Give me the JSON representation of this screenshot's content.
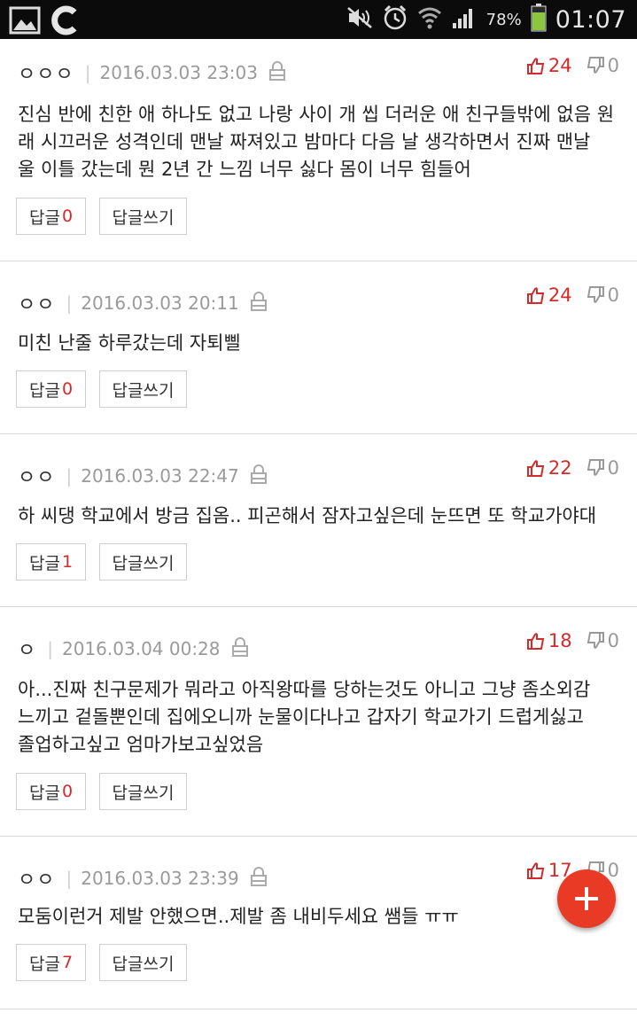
{
  "status_bar": {
    "battery": "78%",
    "time": "01:07",
    "icons": [
      "gallery-icon",
      "app-c-icon",
      "mute-icon",
      "alarm-icon",
      "wifi-icon",
      "signal-icon",
      "battery-icon"
    ]
  },
  "labels": {
    "reply": "답글",
    "write_reply": "답글쓰기"
  },
  "comments": [
    {
      "nick": "ㅇㅇㅇ",
      "date": "2016.03.03 23:03",
      "up": "24",
      "down": "0",
      "lines": [
        "진심 반에 친한 애 하나도 없고 나랑 사이 개 씹 더러운 애 친구들밖에 없음 원",
        "래 시끄러운 성격인데 맨날 짜져있고 밤마다 다음 날 생각하면서 진짜 맨날",
        "울 이틀 갔는데 뭔 2년 간 느낌 너무 싫다 몸이 너무 힘들어"
      ],
      "reply_count": "0"
    },
    {
      "nick": "ㅇㅇ",
      "date": "2016.03.03 20:11",
      "up": "24",
      "down": "0",
      "lines": [
        "미친 난줄 하루갔는데 자퇴삘"
      ],
      "reply_count": "0"
    },
    {
      "nick": "ㅇㅇ",
      "date": "2016.03.03 22:47",
      "up": "22",
      "down": "0",
      "lines": [
        "하 씨댕 학교에서 방금 집옴.. 피곤해서 잠자고싶은데 눈뜨면 또 학교가야대"
      ],
      "reply_count": "1"
    },
    {
      "nick": "ㅇ",
      "date": "2016.03.04 00:28",
      "up": "18",
      "down": "0",
      "lines": [
        "아...진짜 친구문제가 뭐라고 아직왕따를 당하는것도 아니고 그냥 좀소외감",
        "느끼고 겉돌뿐인데 집에오니까 눈물이다나고 갑자기 학교가기 드럽게싫고",
        "졸업하고싶고 엄마가보고싶었음"
      ],
      "reply_count": "0"
    },
    {
      "nick": "ㅇㅇ",
      "date": "2016.03.03 23:39",
      "up": "17",
      "down": "0",
      "lines": [
        "모둠이런거 제발 안했으면..제발 좀 내비두세요 쌤들 ㅠㅠ"
      ],
      "reply_count": "7"
    }
  ]
}
